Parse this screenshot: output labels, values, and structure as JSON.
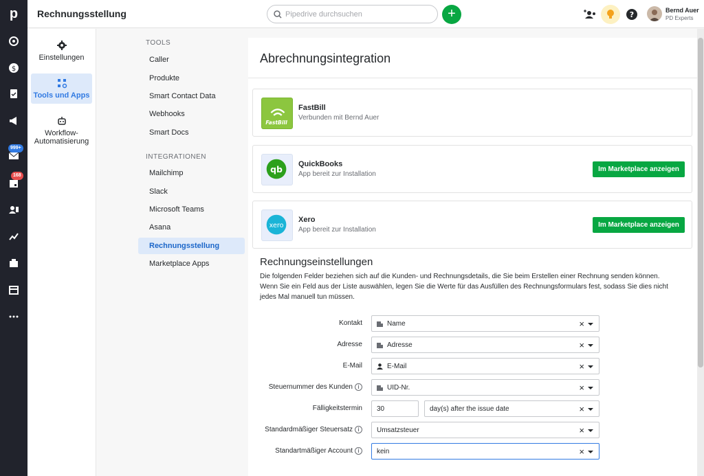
{
  "app": {
    "page_title": "Rechnungsstellung",
    "search_placeholder": "Pipedrive durchsuchen",
    "user_name": "Bernd Auer",
    "user_company": "PD Experts"
  },
  "rail": {
    "logo": "p",
    "badges": {
      "mail": "999+",
      "calendar": "168"
    },
    "icons": [
      "target-icon",
      "deals-icon",
      "tasks-icon",
      "campaigns-icon",
      "mail-icon",
      "calendar-icon",
      "contacts-icon",
      "insights-icon",
      "products-icon",
      "marketplace-icon",
      "more-icon"
    ]
  },
  "settings_nav": [
    {
      "label": "Einstellungen",
      "icon": "gear-icon"
    },
    {
      "label": "Tools und Apps",
      "icon": "tools-icon"
    },
    {
      "label": "Workflow-Automatisierung",
      "icon": "robot-icon"
    }
  ],
  "subnav": {
    "tools_header": "TOOLS",
    "tools": [
      "Caller",
      "Produkte",
      "Smart Contact Data",
      "Webhooks",
      "Smart Docs"
    ],
    "integrations_header": "INTEGRATIONEN",
    "integrations": [
      "Mailchimp",
      "Slack",
      "Microsoft Teams",
      "Asana",
      "Rechnungsstellung",
      "Marketplace Apps"
    ]
  },
  "main": {
    "title": "Abrechnungsintegration",
    "integrations": [
      {
        "name": "FastBill",
        "status": "Verbunden mit Bernd Auer",
        "logo_text": "FastBill"
      },
      {
        "name": "QuickBooks",
        "status": "App bereit zur Installation",
        "logo_text": "qb",
        "button": "Im Marketplace anzeigen"
      },
      {
        "name": "Xero",
        "status": "App bereit zur Installation",
        "logo_text": "xero",
        "button": "Im Marketplace anzeigen"
      }
    ],
    "settings_title": "Rechnungseinstellungen",
    "settings_desc_1": "Die folgenden Felder beziehen sich auf die Kunden- und Rechnungsdetails, die Sie beim Erstellen einer Rechnung senden können.",
    "settings_desc_2": "Wenn Sie ein Feld aus der Liste auswählen, legen Sie die Werte für das Ausfüllen des Rechnungsformulars fest, sodass Sie dies nicht jedes Mal manuell tun müssen.",
    "fields": {
      "kontakt": {
        "label": "Kontakt",
        "value": "Name"
      },
      "adresse": {
        "label": "Adresse",
        "value": "Adresse"
      },
      "email": {
        "label": "E-Mail",
        "value": "E-Mail"
      },
      "steuernummer": {
        "label": "Steuernummer des Kunden",
        "value": "UID-Nr."
      },
      "faelligkeit": {
        "label": "Fälligkeitstermin",
        "days": "30",
        "unit": "day(s) after the issue date"
      },
      "steuersatz": {
        "label": "Standardmäßiger Steuersatz",
        "value": "Umsatzsteuer"
      },
      "account": {
        "label": "Standartmäßiger Account",
        "value": "kein"
      }
    },
    "info_glyph": "i",
    "clear_glyph": "×"
  },
  "colors": {
    "accent_green": "#08a742",
    "active_blue": "#317ae2",
    "rail": "#21232c"
  }
}
